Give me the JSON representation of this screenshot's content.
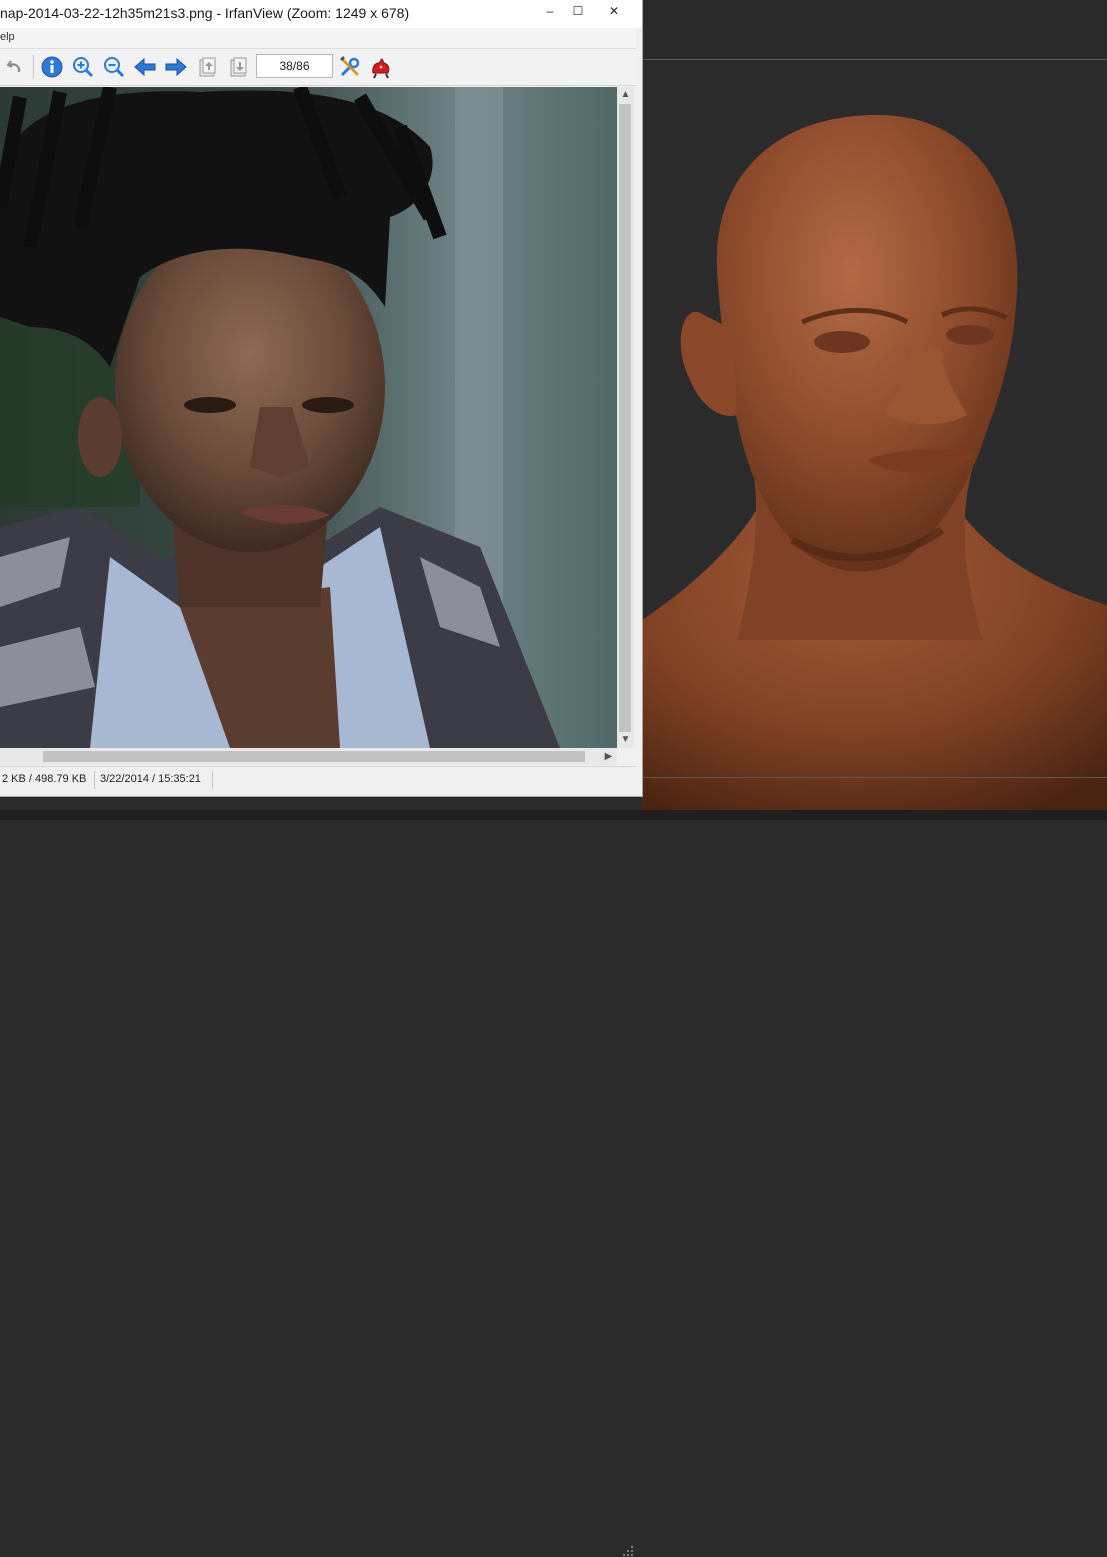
{
  "window": {
    "title": "nap-2014-03-22-12h35m21s3.png - IrfanView (Zoom: 1249 x 678)",
    "minimize_glyph": "–",
    "maximize_glyph": "☐",
    "close_glyph": "✕"
  },
  "menu": {
    "help_label": "elp"
  },
  "toolbar": {
    "page_indicator": "38/86",
    "icons": [
      "undo-icon",
      "info-icon",
      "zoom-in-icon",
      "zoom-out-icon",
      "prev-arrow-icon",
      "next-arrow-icon",
      "copy-up-icon",
      "copy-down-icon",
      "properties-icon",
      "irfan-cat-icon"
    ]
  },
  "status": {
    "size": "2 KB / 498.79 KB",
    "datetime": "3/22/2014 / 15:35:21"
  },
  "colors": {
    "accent_blue": "#2d7ad6",
    "sculpt_clay": "#8a4a2a"
  }
}
